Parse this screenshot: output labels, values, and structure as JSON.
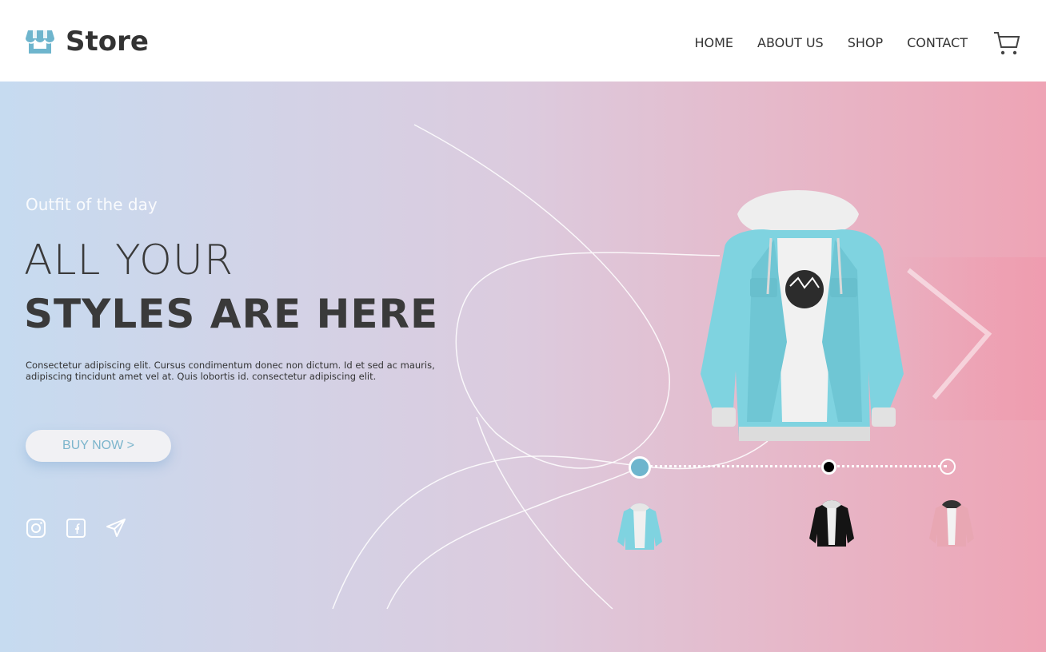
{
  "brand": {
    "name": "Store",
    "icon": "storefront-icon",
    "accent": "#6eb5cd"
  },
  "nav": {
    "items": [
      {
        "label": "HOME"
      },
      {
        "label": "ABOUT US"
      },
      {
        "label": "SHOP"
      },
      {
        "label": "CONTACT"
      }
    ],
    "cart_icon": "cart-icon"
  },
  "hero": {
    "tagline": "Outfit of the day",
    "title_line1": "ALL YOUR",
    "title_line2": "STYLES ARE HERE",
    "description": "Consectetur adipiscing elit. Cursus condimentum donec non dictum. Id et sed ac mauris, adipiscing tincidunt amet vel at. Quis lobortis id. consectetur adipiscing elit.",
    "cta_label": "BUY NOW >",
    "socials": [
      "instagram-icon",
      "facebook-icon",
      "send-icon"
    ],
    "gradient": {
      "start": "#c6dbf0",
      "end": "#eea4b5"
    }
  },
  "product_slider": {
    "active_index": 0,
    "items": [
      {
        "color_name": "blue",
        "dot_color": "#6eb5cd"
      },
      {
        "color_name": "black",
        "dot_color": "#000000"
      },
      {
        "color_name": "pink",
        "dot_color": "#ffffff"
      }
    ],
    "jacket_color": "#7fd3e0",
    "next_icon": "chevron-right-icon"
  }
}
